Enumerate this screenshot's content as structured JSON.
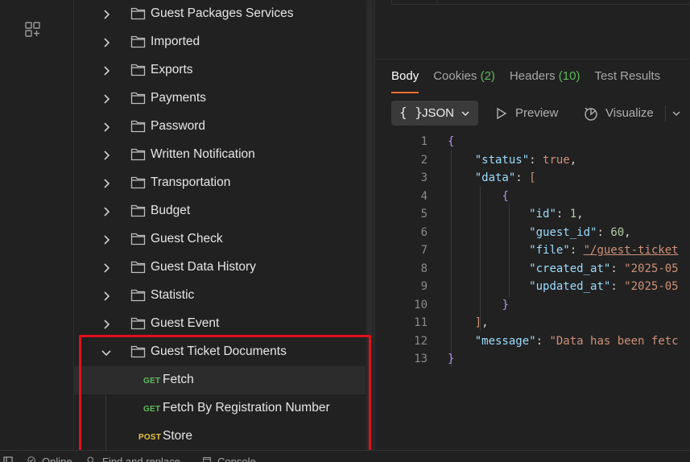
{
  "sidebar": {
    "folders": [
      {
        "label": "Guest Packages Services"
      },
      {
        "label": "Imported"
      },
      {
        "label": "Exports"
      },
      {
        "label": "Payments"
      },
      {
        "label": "Password"
      },
      {
        "label": "Written Notification"
      },
      {
        "label": "Transportation"
      },
      {
        "label": "Budget"
      },
      {
        "label": "Guest Check"
      },
      {
        "label": "Guest Data History"
      },
      {
        "label": "Statistic"
      },
      {
        "label": "Guest Event"
      }
    ],
    "expanded_folder": {
      "label": "Guest Ticket Documents",
      "children": [
        {
          "method": "GET",
          "label": "Fetch"
        },
        {
          "method": "GET",
          "label": "Fetch By Registration Number"
        },
        {
          "method": "POST",
          "label": "Store"
        }
      ]
    }
  },
  "response": {
    "tabs": [
      {
        "label": "Body"
      },
      {
        "label": "Cookies",
        "count": "(2)"
      },
      {
        "label": "Headers",
        "count": "(10)"
      },
      {
        "label": "Test Results"
      }
    ],
    "format": {
      "braces": "{ }",
      "label": "JSON"
    },
    "preview_label": "Preview",
    "visualize_label": "Visualize",
    "code": {
      "line_numbers": [
        "1",
        "2",
        "3",
        "4",
        "5",
        "6",
        "7",
        "8",
        "9",
        "10",
        "11",
        "12",
        "13"
      ],
      "status_key": "\"status\"",
      "status_val": "true",
      "data_key": "\"data\"",
      "id_key": "\"id\"",
      "id_val": "1",
      "guest_id_key": "\"guest_id\"",
      "guest_id_val": "60",
      "file_key": "\"file\"",
      "file_val": "\"/guest-ticket",
      "created_key": "\"created_at\"",
      "created_val": "\"2025-05",
      "updated_key": "\"updated_at\"",
      "updated_val": "\"2025-05",
      "message_key": "\"message\"",
      "message_val": "\"Data has been fetc"
    }
  },
  "statusbar": {
    "online": "Online",
    "find": "Find and replace",
    "console": "Console"
  },
  "colors": {
    "get": "#5fb95f",
    "post": "#e8c547",
    "accent": "#ff6c37",
    "highlight_box": "#e0101a"
  }
}
